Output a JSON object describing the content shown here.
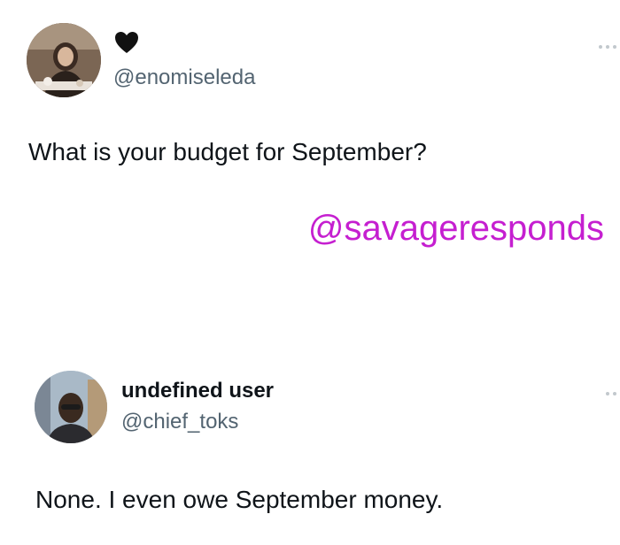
{
  "watermark": "@savageresponds",
  "tweets": [
    {
      "display_name_icon": "black-heart-icon",
      "handle": "@enomiseleda",
      "text": "What is your budget for September?"
    },
    {
      "display_name": "undefined user",
      "handle": "@chief_toks",
      "text": "None. I even owe September money."
    }
  ],
  "colors": {
    "text": "#0f1419",
    "secondary": "#536471",
    "watermark": "#c51fd0"
  }
}
